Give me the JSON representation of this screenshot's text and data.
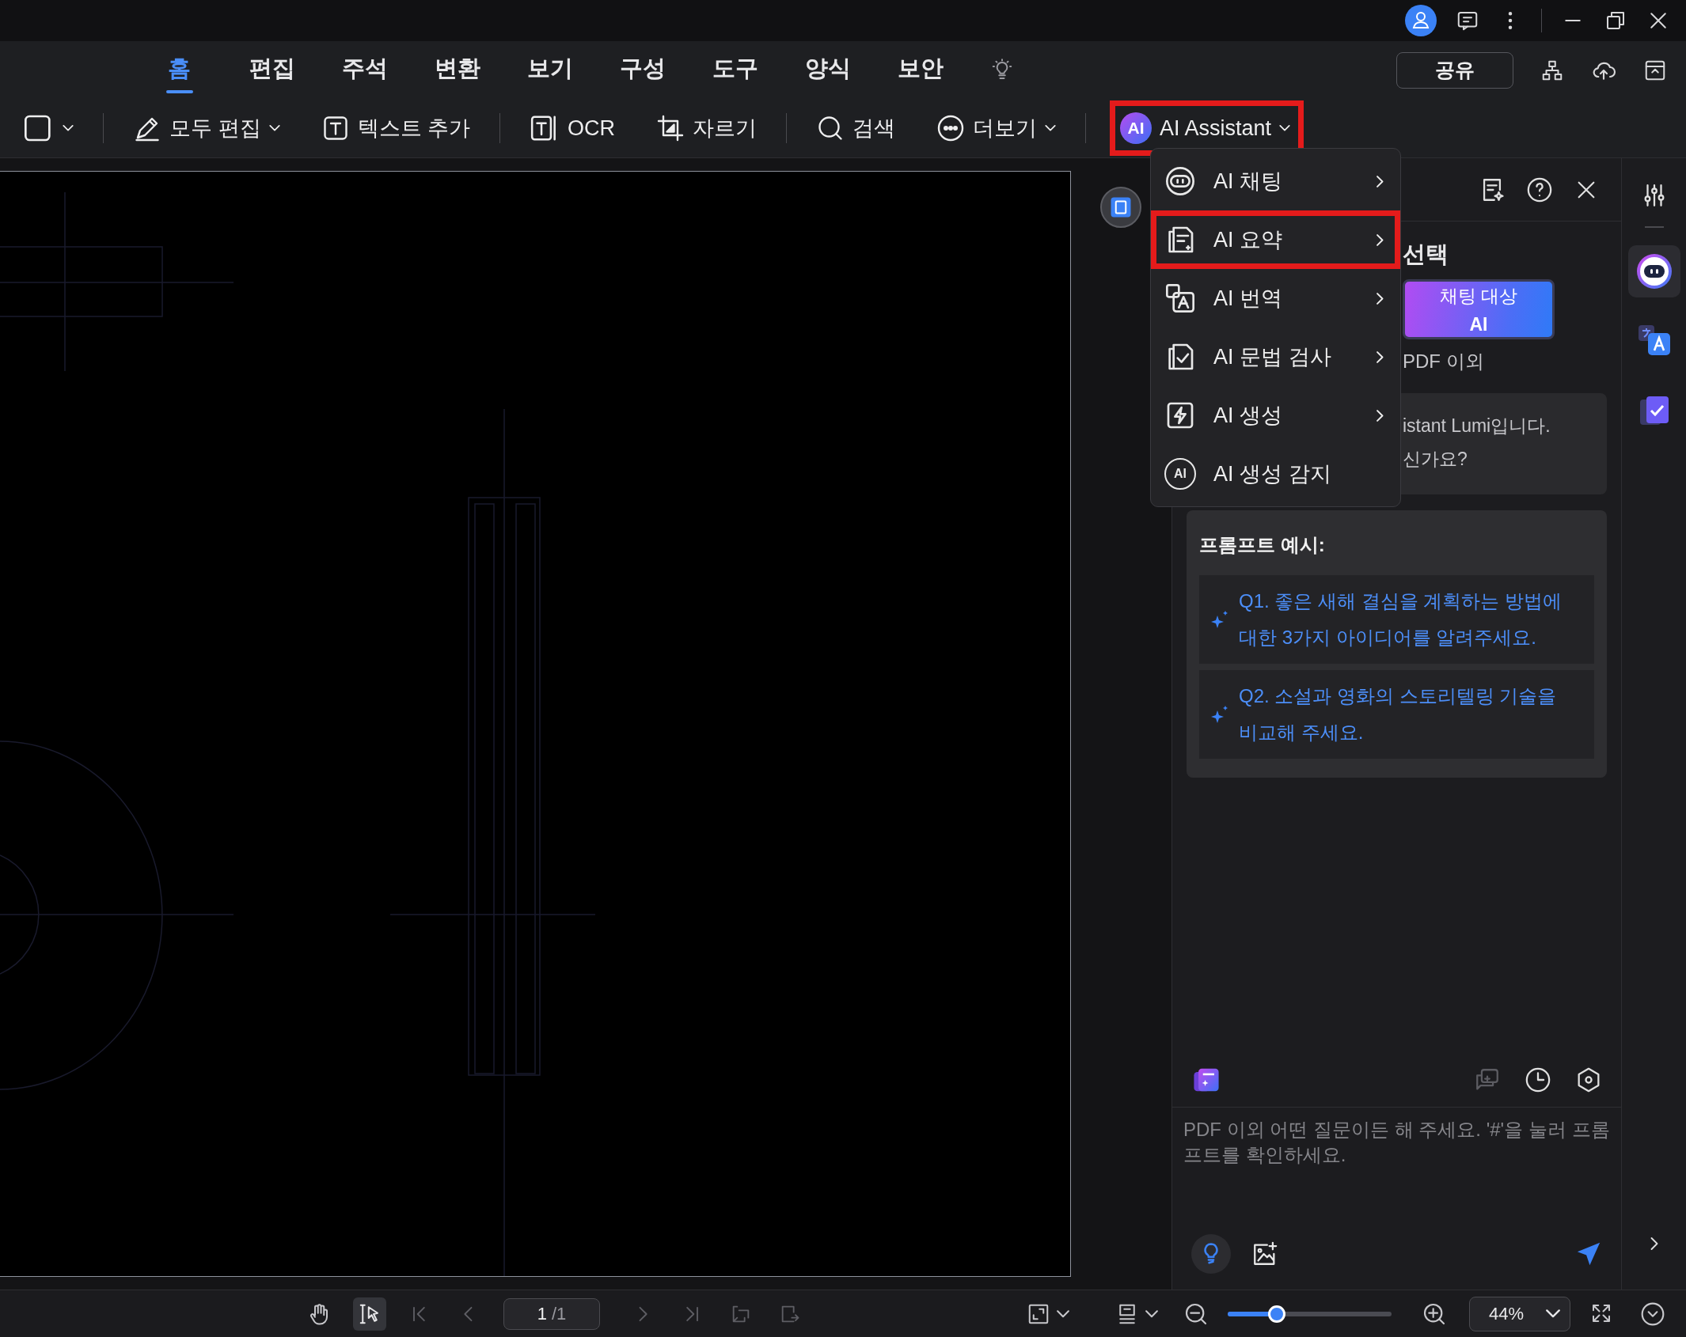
{
  "tabs": [
    {
      "label": "홈",
      "selected": true
    },
    {
      "label": "편집",
      "selected": false
    },
    {
      "label": "주석",
      "selected": false
    },
    {
      "label": "변환",
      "selected": false
    },
    {
      "label": "보기",
      "selected": false
    },
    {
      "label": "구성",
      "selected": false
    },
    {
      "label": "도구",
      "selected": false
    },
    {
      "label": "양식",
      "selected": false
    },
    {
      "label": "보안",
      "selected": false
    }
  ],
  "share_button": "공유",
  "toolbar_groups": [
    [
      {
        "kind": "shape",
        "dropdown": true,
        "highlighted": false
      }
    ],
    [
      {
        "kind": "edit",
        "label": "모두 편집",
        "dropdown": true,
        "highlighted": false
      },
      {
        "kind": "text",
        "label": "텍스트 추가",
        "dropdown": false,
        "highlighted": false
      }
    ],
    [
      {
        "kind": "ocr",
        "label": "OCR",
        "dropdown": false,
        "highlighted": false
      },
      {
        "kind": "crop",
        "label": "자르기",
        "dropdown": false,
        "highlighted": false
      }
    ],
    [
      {
        "kind": "search",
        "label": "검색",
        "dropdown": false,
        "highlighted": false
      },
      {
        "kind": "more",
        "label": "더보기",
        "dropdown": true,
        "highlighted": false
      }
    ],
    [
      {
        "kind": "ai",
        "badge": "AI",
        "label": "AI Assistant",
        "dropdown": true,
        "highlighted": true
      }
    ]
  ],
  "ai_menu": [
    {
      "kind": "chat",
      "label": "AI 채팅",
      "submenu": true,
      "highlighted": false
    },
    {
      "kind": "summary",
      "label": "AI 요약",
      "submenu": true,
      "highlighted": true
    },
    {
      "kind": "translate",
      "label": "AI 번역",
      "submenu": true,
      "highlighted": false
    },
    {
      "kind": "grammar",
      "label": "AI 문법 검사",
      "submenu": true,
      "highlighted": false
    },
    {
      "kind": "generate",
      "label": "AI 생성",
      "submenu": true,
      "highlighted": false
    },
    {
      "kind": "detect",
      "badge": "AI",
      "label": "AI 생성 감지",
      "submenu": false,
      "highlighted": false
    }
  ],
  "ai_panel": {
    "heading": "선택",
    "chat_target_button": {
      "line_1": "채팅 대상",
      "line_2": "AI"
    },
    "scope": "PDF 이외",
    "message": [
      "istant Lumi입니다.",
      "신가요?"
    ],
    "prompt_examples": {
      "title": "프롬프트 예시:",
      "items": [
        "Q1. 좋은 새해 결심을 계획하는 방법에 대한 3가지 아이디어를 알려주세요.",
        "Q2. 소설과 영화의 스토리텔링 기술을 비교해 주세요."
      ]
    },
    "input": {
      "placeholder": "PDF 이외 어떤 질문이든 해 주세요. '#'을 눌러 프롬프트를 확인하세요."
    }
  },
  "rail_tools": [
    {
      "kind": "assistant",
      "selected": true
    },
    {
      "kind": "translate",
      "selected": false
    },
    {
      "kind": "check",
      "selected": false
    }
  ],
  "status_bar": {
    "tools": [
      {
        "kind": "hand",
        "selected": false
      },
      {
        "kind": "select",
        "selected": true
      }
    ],
    "page_current": "1",
    "page_total": "/1",
    "zoom_slider": {
      "level": 0.3
    },
    "zoom_value": "44%"
  }
}
